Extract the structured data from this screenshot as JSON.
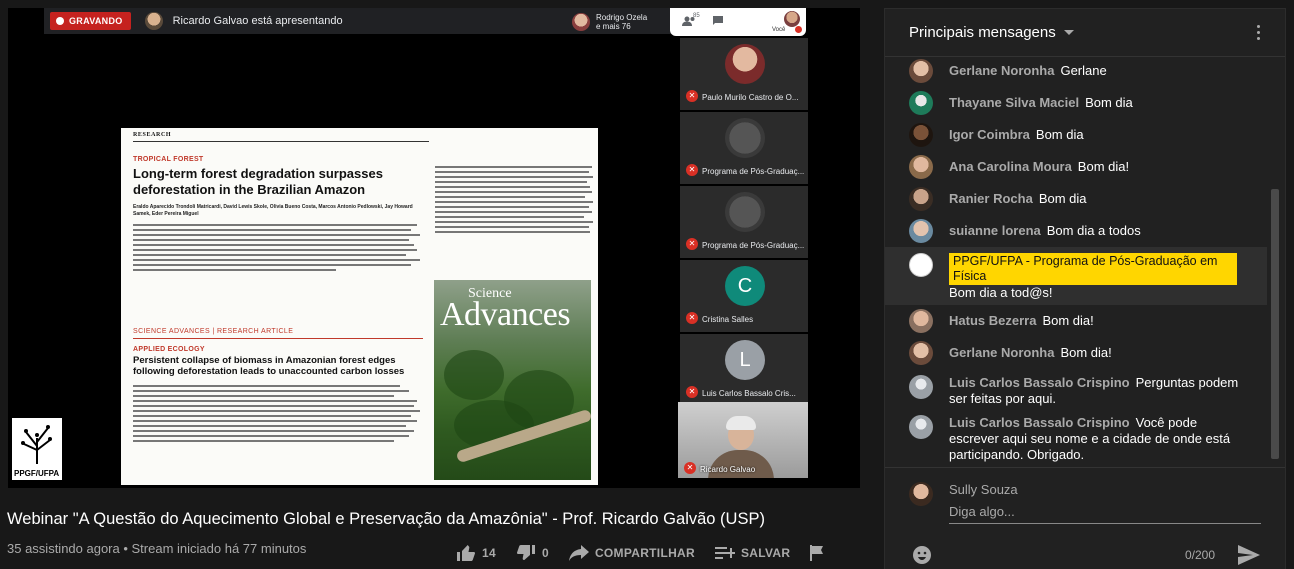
{
  "meet": {
    "recording_label": "GRAVANDO",
    "presenter_text": "Ricardo Galvao está apresentando",
    "participants_text": "Rodrigo Ozela\ne mais 76",
    "participant_count": "85",
    "self_label": "Você",
    "tiles": [
      {
        "name": "Paulo Murilo Castro de O...",
        "kind": "photo"
      },
      {
        "name": "Programa de Pós-Graduaç...",
        "kind": "photo"
      },
      {
        "name": "Programa de Pós-Graduaç...",
        "kind": "photo"
      },
      {
        "name": "Cristina Salles",
        "kind": "letter",
        "letter": "C",
        "color": "#0f8a7a"
      },
      {
        "name": "Luis Carlos Bassalo Cris...",
        "kind": "letter",
        "letter": "L",
        "color": "#9aa0a6"
      }
    ],
    "camera_name": "Ricardo Galvao"
  },
  "paper": {
    "section": "RESEARCH",
    "kicker": "TROPICAL FOREST",
    "title": "Long-term forest degradation surpasses deforestation in the Brazilian Amazon",
    "authors": "Eraldo Aparecido Trondoli Matricardi, David Lewis Skole, Olivia Bueno Costa, Marcos Antonio Pedlowski, Jay Howard Samek, Eder Pereira Miguel",
    "journal_line": "SCIENCE ADVANCES | RESEARCH ARTICLE",
    "kicker2": "APPLIED ECOLOGY",
    "title2": "Persistent collapse of biomass in Amazonian forest edges following deforestation leads to unaccounted carbon losses",
    "cover_title_small": "Science",
    "cover_title_big": "Advances"
  },
  "logo_text": "PPGF/UFPA",
  "video": {
    "title": "Webinar \"A Questão do Aquecimento Global e Preservação da Amazônia\" - Prof. Ricardo Galvão (USP)",
    "meta": "35 assistindo agora • Stream iniciado há 77 minutos",
    "likes": "14",
    "dislikes": "0",
    "share_label": "COMPARTILHAR",
    "save_label": "SALVAR"
  },
  "chat": {
    "header": "Principais mensagens",
    "messages": [
      {
        "author": "Gerlane Noronha",
        "text": "Gerlane",
        "avatar_color": "#c9a38a"
      },
      {
        "author": "Thayane Silva Maciel",
        "text": "Bom dia",
        "avatar_color": "#1e7b5a"
      },
      {
        "author": "Igor Coimbra",
        "text": "Bom dia",
        "avatar_color": "#3a2a1e"
      },
      {
        "author": "Ana Carolina Moura",
        "text": "Bom dia!",
        "avatar_color": "#c99a7a"
      },
      {
        "author": "Ranier Rocha",
        "text": "Bom dia",
        "avatar_color": "#5a4638"
      },
      {
        "author": "suianne lorena",
        "text": "Bom dia a todos",
        "avatar_color": "#6a8aa0"
      },
      {
        "author": "PPGF/UFPA - Programa de Pós-Graduação em Física",
        "text": "Bom dia a tod@s!",
        "avatar_color": "#ffffff",
        "owner": true
      },
      {
        "author": "Hatus Bezerra",
        "text": "Bom dia!",
        "avatar_color": "#b08a70"
      },
      {
        "author": "Gerlane Noronha",
        "text": "Bom dia!",
        "avatar_color": "#c9a38a"
      },
      {
        "author": "Luis Carlos Bassalo Crispino",
        "text": "Perguntas podem ser feitas por aqui.",
        "avatar_color": "#9aa0a6"
      },
      {
        "author": "Luis Carlos Bassalo Crispino",
        "text": "Você pode escrever aqui seu nome e a cidade de onde está participando. Obrigado.",
        "avatar_color": "#9aa0a6"
      }
    ],
    "composer": {
      "user": "Sully Souza",
      "placeholder": "Diga algo...",
      "counter": "0/200"
    }
  }
}
